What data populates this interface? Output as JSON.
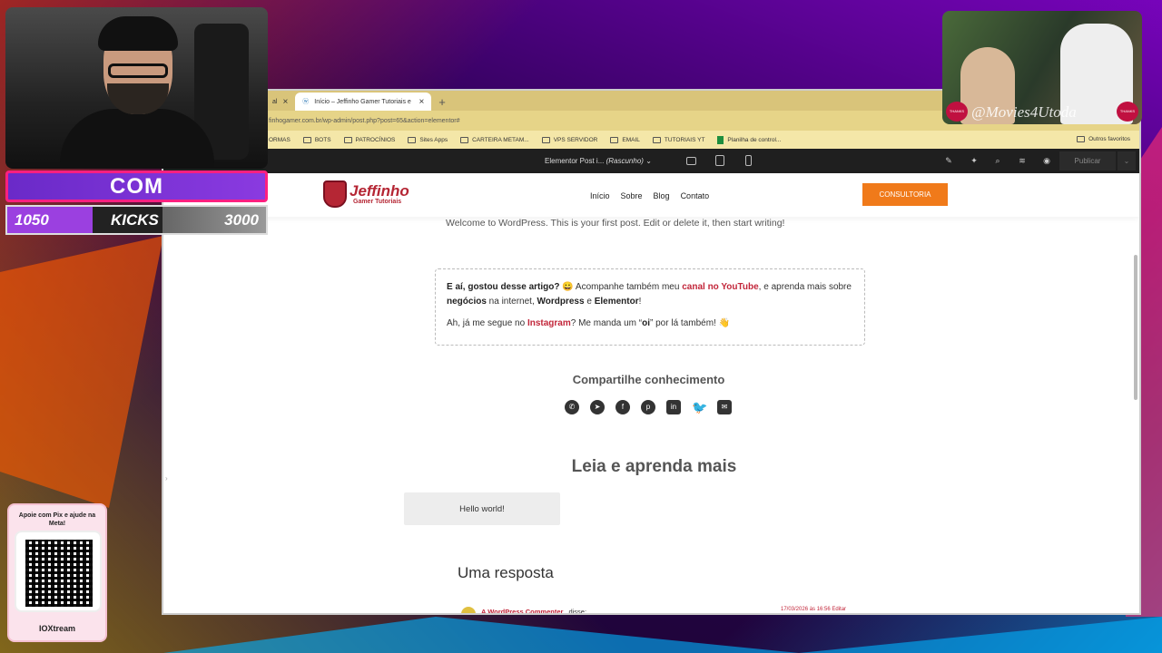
{
  "browser": {
    "tabs": [
      {
        "label": "al"
      },
      {
        "label": "Início – Jeffinho Gamer Tutoriais e"
      }
    ],
    "address": "finhogamer.com.br/wp-admin/post.php?post=65&action=elementor#",
    "bookmarks": [
      {
        "label": "ORMAS"
      },
      {
        "label": "BOTS"
      },
      {
        "label": "PATROCÍNIOS"
      },
      {
        "label": "Sites Apps"
      },
      {
        "label": "CARTEIRA METAM..."
      },
      {
        "label": "VPS SERVIDOR"
      },
      {
        "label": "EMAIL"
      },
      {
        "label": "TUTORIAIS YT"
      },
      {
        "label": "Planilha de control..."
      }
    ],
    "other_bookmarks": "Outros favoritos"
  },
  "elementor": {
    "doc_title": "Elementor Post i...",
    "doc_status": "(Rascunho)",
    "publish_label": "Publicar"
  },
  "site": {
    "logo_line1": "Jeffinho",
    "logo_line2": "Gamer Tutoriais",
    "nav": [
      "Início",
      "Sobre",
      "Blog",
      "Contato"
    ],
    "cta": "CONSULTORIA",
    "welcome": "Welcome to WordPress. This is your first post. Edit or delete it, then start writing!",
    "box": {
      "p1_a": "E aí, gostou desse artigo?",
      "p1_b": " 😀 Acompanhe também meu ",
      "p1_link": "canal no YouTube",
      "p1_c": ", e aprenda mais sobre ",
      "p1_bold1": "negócios",
      "p1_d": " na internet, ",
      "p1_bold2": "Wordpress",
      "p1_e": " e ",
      "p1_bold3": "Elementor",
      "p1_f": "!",
      "p2_a": "Ah, já me segue no ",
      "p2_link": "Instagram",
      "p2_b": "? Me manda um “",
      "p2_bold": "oi",
      "p2_c": "” por lá também! 👋"
    },
    "share_title": "Compartilhe conhecimento",
    "share_icons": [
      "whatsapp-icon",
      "telegram-icon",
      "facebook-icon",
      "pinterest-icon",
      "linkedin-icon",
      "twitter-icon",
      "email-icon"
    ],
    "read_more_title": "Leia e aprenda mais",
    "related_post": "Hello world!",
    "reply_title": "Uma resposta",
    "comment_author": "A WordPress Commenter",
    "comment_said": "disse:",
    "comment_date": "17/03/2026 às 16:56 Editar"
  },
  "overlay": {
    "com_label": "COM",
    "kicks_left": "1050",
    "kicks_label": "KICKS",
    "kicks_right": "3000",
    "pix_title": "Apoie com Pix e ajude na Meta!",
    "pix_brand": "IOXtream",
    "movie_watermark": "@Movies4Utoda",
    "movie_badge": "THANKS FOR WATCHING"
  },
  "colors": {
    "accent_red": "#c2263a",
    "cta_orange": "#f07a1a",
    "tabbar_yellow": "#d9c47a",
    "elementor_bar": "#1f1f1f"
  }
}
